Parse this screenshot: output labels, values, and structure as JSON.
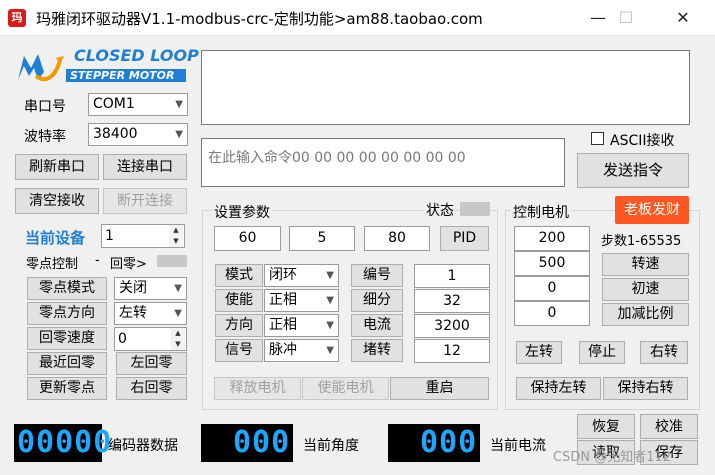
{
  "window": {
    "title": "玛雅闭环驱动器V1.1-modbus-crc-定制功能>am88.taobao.com",
    "icon_text": "玛",
    "min": "—",
    "max": "☐",
    "close": "✕"
  },
  "logo": {
    "line1": "CLOSED LOOP",
    "line2": "STEPPER MOTOR",
    "colors": {
      "blue": "#1f7fd6",
      "orange": "#f39800"
    }
  },
  "serial": {
    "port_label": "串口号",
    "port_value": "COM1",
    "baud_label": "波特率",
    "baud_value": "38400",
    "refresh": "刷新串口",
    "connect": "连接串口",
    "clear": "清空接收",
    "disconnect": "断开连接"
  },
  "device": {
    "label": "当前设备",
    "value": "1"
  },
  "zero": {
    "title": "零点控制",
    "sep": "-",
    "return": "回零>",
    "mode_btn": "零点模式",
    "mode_value": "关闭",
    "dir_btn": "零点方向",
    "dir_value": "左转",
    "speed_btn": "回零速度",
    "speed_value": "0",
    "nearest": "最近回零",
    "left_return": "左回零",
    "update": "更新零点",
    "right_return": "右回零"
  },
  "receive": {
    "text": "",
    "ascii_label": "ASCII接收"
  },
  "send": {
    "placeholder": "在此输入命令00 00 00 00 00 00 00 00",
    "button": "发送指令"
  },
  "settings": {
    "title": "设置参数",
    "status_label": "状态",
    "vals": [
      "60",
      "5",
      "80"
    ],
    "pid": "PID",
    "rows": [
      {
        "btn": "模式",
        "combo": "闭环",
        "lbl_btn": "编号",
        "val": "1"
      },
      {
        "btn": "使能",
        "combo": "正相",
        "lbl_btn": "细分",
        "val": "32"
      },
      {
        "btn": "方向",
        "combo": "正相",
        "lbl_btn": "电流",
        "val": "3200"
      },
      {
        "btn": "信号",
        "combo": "脉冲",
        "lbl_btn": "堵转",
        "val": "12"
      }
    ],
    "release": "释放电机",
    "enable": "使能电机",
    "restart": "重启"
  },
  "motor": {
    "title": "控制电机",
    "promo": "老板发财",
    "promo_color": "#ff5722",
    "steps_label": "步数1-65535",
    "vals": [
      "200",
      "500",
      "0",
      "0"
    ],
    "speed": "转速",
    "init_speed": "初速",
    "accel": "加减比例",
    "left": "左转",
    "stop": "停止",
    "right": "右转",
    "hold_left": "保持左转",
    "hold_right": "保持右转"
  },
  "readouts": {
    "encoder_digits": "00000",
    "encoder_label": "编码器数据",
    "angle_digits": "000",
    "angle_label": "当前角度",
    "current_digits": "000",
    "current_label": "当前电流"
  },
  "bottom_buttons": {
    "restore": "恢复",
    "calibrate": "校准",
    "read": "读取",
    "save": "保存"
  },
  "watermark": "CSDN @无知者112"
}
